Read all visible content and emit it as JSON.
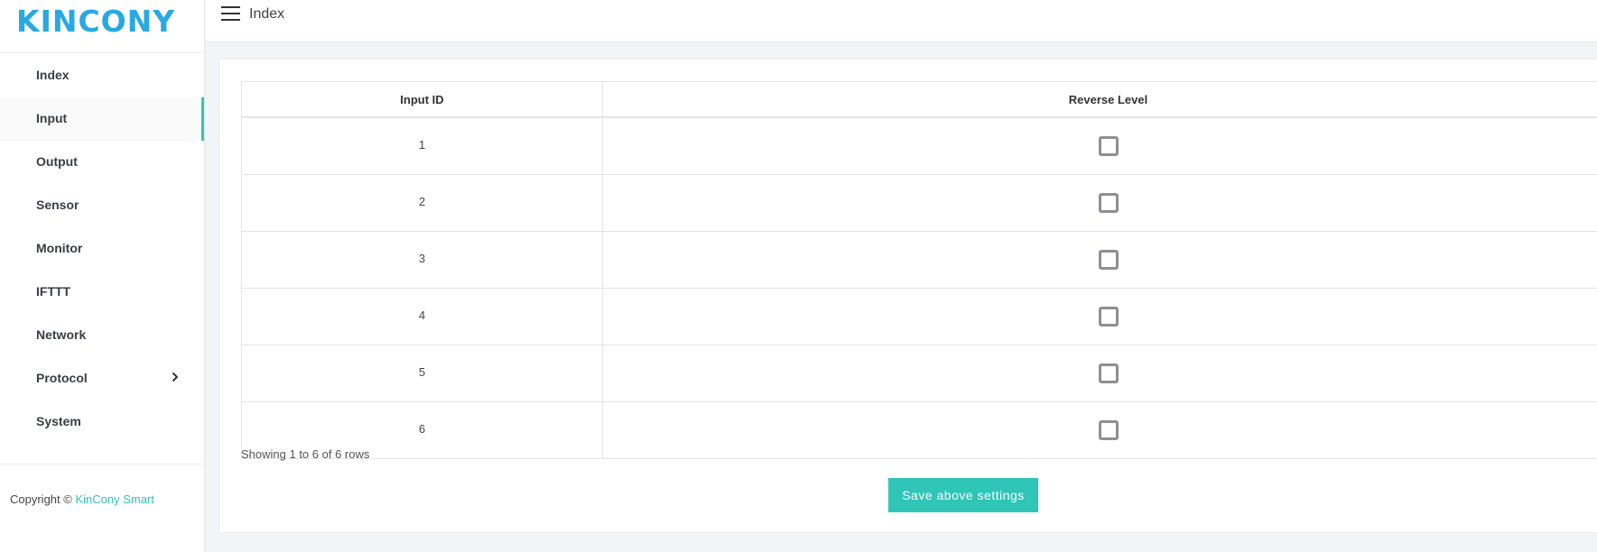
{
  "brand": {
    "logo_text": "KINCONY",
    "accent_color": "#2fc5b7",
    "logo_color": "#29a9e1"
  },
  "sidebar": {
    "items": [
      {
        "label": "Index",
        "active": false
      },
      {
        "label": "Input",
        "active": true
      },
      {
        "label": "Output",
        "active": false
      },
      {
        "label": "Sensor",
        "active": false
      },
      {
        "label": "Monitor",
        "active": false
      },
      {
        "label": "IFTTT",
        "active": false
      },
      {
        "label": "Network",
        "active": false
      },
      {
        "label": "Protocol",
        "active": false,
        "has_submenu": true,
        "submenu_icon": "chevron-right-icon"
      },
      {
        "label": "System",
        "active": false
      }
    ],
    "copyright_prefix": "Copyright ©",
    "copyright_brand": "KinCony Smart"
  },
  "topbar": {
    "menu_icon": "hamburger-icon",
    "breadcrumb": "Index"
  },
  "table": {
    "headers": [
      "Input ID",
      "Reverse Level"
    ],
    "rows": [
      {
        "id": "1",
        "reverse_level": false
      },
      {
        "id": "2",
        "reverse_level": false
      },
      {
        "id": "3",
        "reverse_level": false
      },
      {
        "id": "4",
        "reverse_level": false
      },
      {
        "id": "5",
        "reverse_level": false
      },
      {
        "id": "6",
        "reverse_level": false
      }
    ],
    "pagination_text": "Showing 1 to 6 of 6 rows"
  },
  "actions": {
    "save_label": "Save above settings"
  }
}
